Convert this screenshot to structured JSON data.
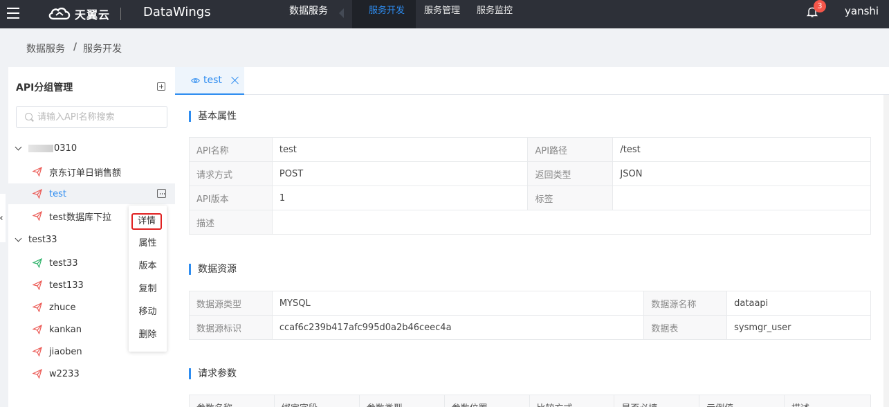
{
  "header": {
    "logo_text": "天翼云",
    "product_name": "DataWings",
    "primary_nav": "数据服务",
    "tabs": [
      {
        "label": "服务开发",
        "active": true
      },
      {
        "label": "服务管理",
        "active": false
      },
      {
        "label": "服务监控",
        "active": false
      }
    ],
    "notification_count": "3",
    "username": "yanshi"
  },
  "breadcrumb": {
    "root": "数据服务",
    "separator": "/",
    "current": "服务开发"
  },
  "sidebar": {
    "title": "API分组管理",
    "search_placeholder": "请输入API名称搜索",
    "groups": [
      {
        "name_suffix": "0310",
        "items": [
          {
            "label": "京东订单日销售额",
            "icon_color": "#ec5b56"
          },
          {
            "label": "test",
            "icon_color": "#ec5b56",
            "selected": true
          },
          {
            "label": "test数据库下拉",
            "icon_color": "#ec5b56"
          }
        ]
      },
      {
        "name": "test33",
        "items": [
          {
            "label": "test33",
            "icon_color": "#2fb36a"
          },
          {
            "label": "test133",
            "icon_color": "#ec5b56"
          },
          {
            "label": "zhuce",
            "icon_color": "#ec5b56"
          },
          {
            "label": "kankan",
            "icon_color": "#ec5b56"
          },
          {
            "label": "jiaoben",
            "icon_color": "#ec5b56"
          },
          {
            "label": "w2233",
            "icon_color": "#ec5b56"
          }
        ]
      }
    ]
  },
  "context_menu": [
    "详情",
    "属性",
    "版本",
    "复制",
    "移动",
    "删除"
  ],
  "main": {
    "tab_label": "test",
    "basic": {
      "title": "基本属性",
      "rows": [
        [
          "API名称",
          "test",
          "API路径",
          "/test"
        ],
        [
          "请求方式",
          "POST",
          "返回类型",
          "JSON"
        ],
        [
          "API版本",
          "1",
          "标签",
          ""
        ],
        [
          "描述",
          ""
        ]
      ]
    },
    "datasource": {
      "title": "数据资源",
      "rows": [
        [
          "数据源类型",
          "MYSQL",
          "数据源名称",
          "dataapi"
        ],
        [
          "数据源标识",
          "ccaf6c239b417afc995d0a2b46ceec4a",
          "数据表",
          "sysmgr_user"
        ]
      ]
    },
    "request_params": {
      "title": "请求参数",
      "columns": [
        "参数名称",
        "绑定字段",
        "参数类型",
        "参数位置",
        "比较方式",
        "是否必填",
        "示例值",
        "描述"
      ]
    }
  },
  "colors": {
    "accent": "#2d8cf0",
    "topbar": "#2d3038",
    "highlight_border": "#e02020"
  }
}
